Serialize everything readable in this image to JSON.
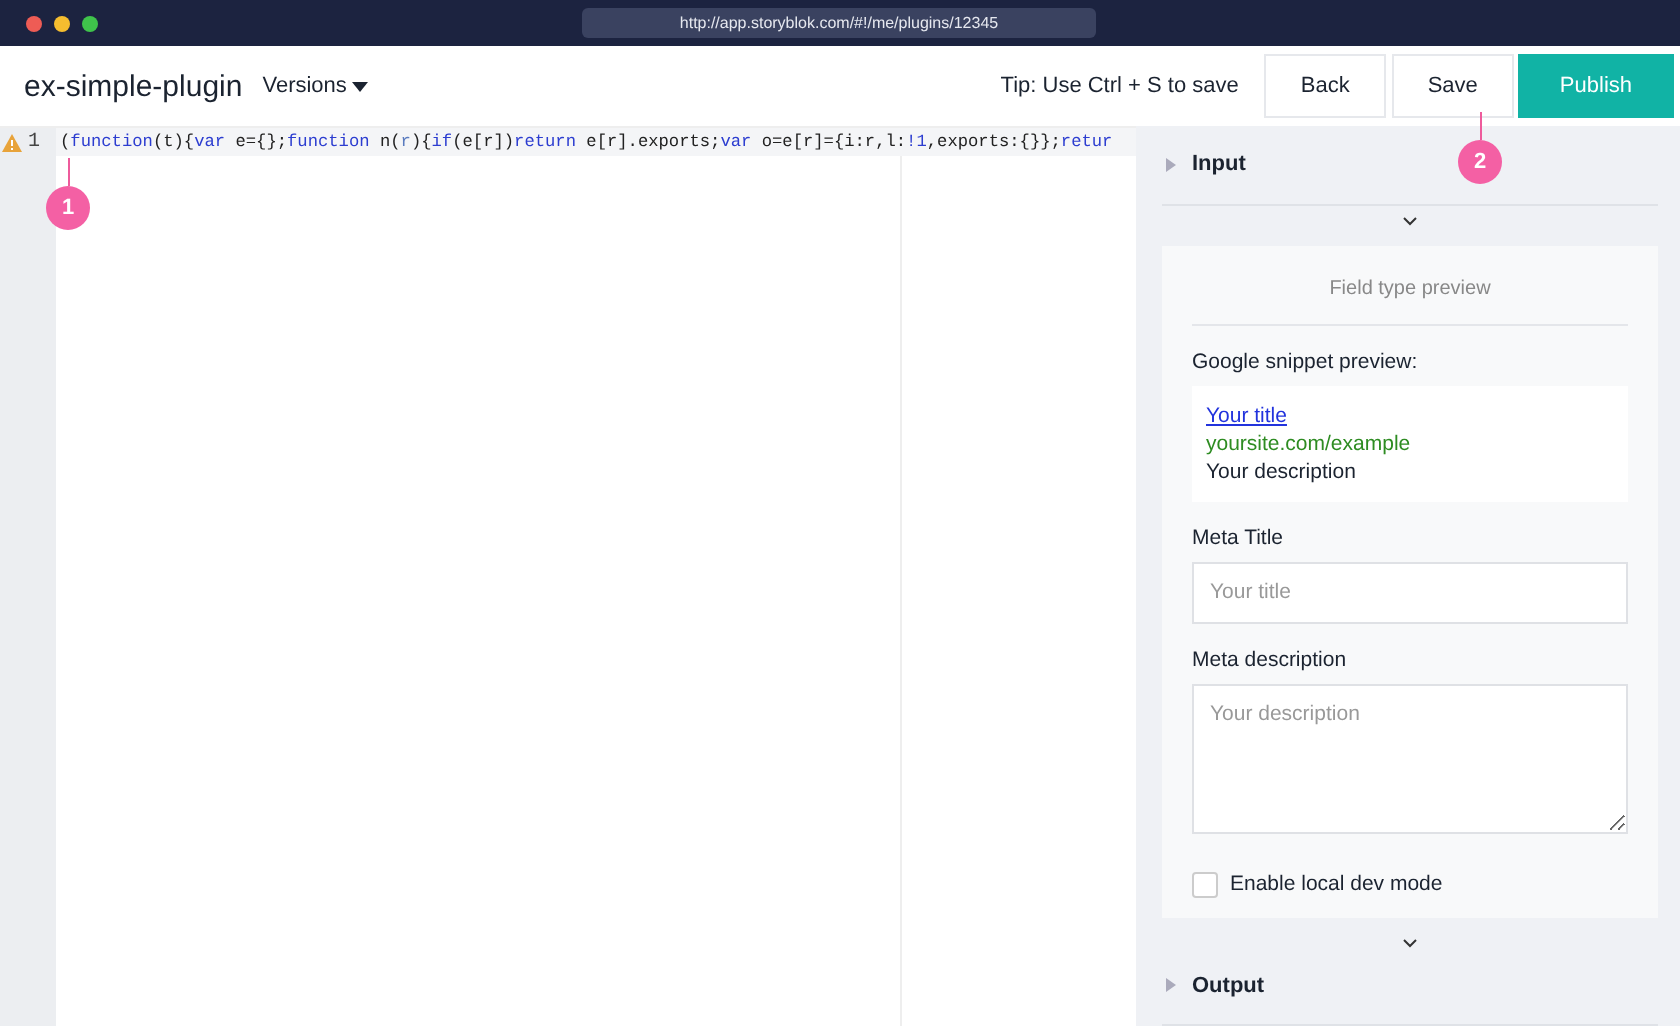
{
  "browser": {
    "url": "http://app.storyblok.com/#!/me/plugins/12345"
  },
  "header": {
    "title": "ex-simple-plugin",
    "versions": "Versions",
    "tip": "Tip: Use Ctrl + S to save",
    "buttons": [
      {
        "label": "Back",
        "kind": "plain"
      },
      {
        "label": "Save",
        "kind": "plain"
      },
      {
        "label": "Publish",
        "kind": "primary"
      }
    ]
  },
  "editor": {
    "lines": [
      {
        "number": "1",
        "warning": true,
        "tokens": [
          {
            "text": "(",
            "kind": "plain"
          },
          {
            "text": "function",
            "kind": "keyword"
          },
          {
            "text": "(t){",
            "kind": "plain"
          },
          {
            "text": "var",
            "kind": "keyword"
          },
          {
            "text": " e={};",
            "kind": "plain"
          },
          {
            "text": "function",
            "kind": "keyword"
          },
          {
            "text": " n(",
            "kind": "plain"
          },
          {
            "text": "r",
            "kind": "param"
          },
          {
            "text": "){",
            "kind": "plain"
          },
          {
            "text": "if",
            "kind": "keyword"
          },
          {
            "text": "(e[r])",
            "kind": "plain"
          },
          {
            "text": "return",
            "kind": "keyword"
          },
          {
            "text": " e[r].exports;",
            "kind": "plain"
          },
          {
            "text": "var",
            "kind": "keyword"
          },
          {
            "text": " o=e[r]={i:r,l:",
            "kind": "plain"
          },
          {
            "text": "!1",
            "kind": "number"
          },
          {
            "text": ",exports:{}};",
            "kind": "plain"
          },
          {
            "text": "retur",
            "kind": "keyword"
          }
        ]
      }
    ]
  },
  "panel": {
    "input_section": "Input",
    "preview": {
      "heading": "Field type preview",
      "snippet_label": "Google snippet preview:",
      "snippet_title": "Your title",
      "snippet_url": "yoursite.com/example",
      "snippet_description": "Your description",
      "meta_title": {
        "label": "Meta Title",
        "placeholder": "Your title"
      },
      "meta_description": {
        "label": "Meta description",
        "placeholder": "Your description"
      },
      "dev_mode": {
        "label": "Enable local dev mode",
        "checked": false
      }
    },
    "output_section": "Output"
  },
  "markers": [
    {
      "label": "1"
    },
    {
      "label": "2"
    }
  ]
}
